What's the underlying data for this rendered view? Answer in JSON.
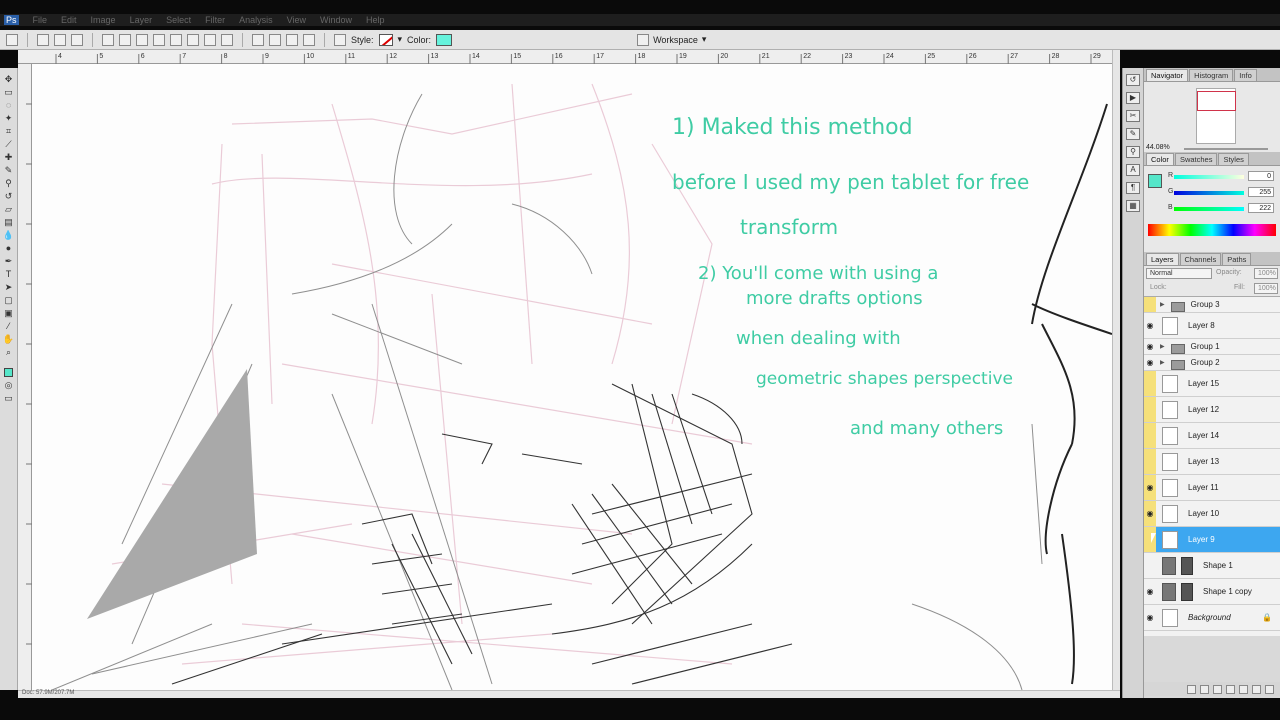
{
  "menubar": {
    "logo": "Ps",
    "items": [
      "File",
      "Edit",
      "Image",
      "Layer",
      "Select",
      "Filter",
      "Analysis",
      "View",
      "Window",
      "Help"
    ]
  },
  "options": {
    "style_label": "Style:",
    "color_label": "Color:",
    "color_value": "#66f2dc",
    "workspace_label": "Workspace"
  },
  "ruler": {
    "ticks": [
      "4",
      "5",
      "6",
      "7",
      "8",
      "9",
      "10",
      "11",
      "12",
      "13",
      "14",
      "15",
      "16",
      "17",
      "18",
      "19",
      "20",
      "21",
      "22",
      "23",
      "24",
      "25",
      "26",
      "27",
      "28",
      "29"
    ]
  },
  "canvas": {
    "note_lines": [
      "1) Maked this method",
      "before I used my pen tablet for free",
      "transform",
      "2) You'll come with using a",
      "more drafts options",
      "when dealing with",
      "geometric shapes perspective",
      "and many others"
    ]
  },
  "status": {
    "text": "Doc: 57.9M/207.7M"
  },
  "navigator": {
    "tabs": [
      "Navigator",
      "Histogram",
      "Info"
    ],
    "zoom": "44.08%"
  },
  "color_panel": {
    "tabs": [
      "Color",
      "Swatches",
      "Styles"
    ],
    "fg_color": "#55e6c9",
    "channels": [
      {
        "label": "R",
        "value": "0"
      },
      {
        "label": "G",
        "value": "255"
      },
      {
        "label": "B",
        "value": "222"
      }
    ]
  },
  "layers_panel": {
    "tabs": [
      "Layers",
      "Channels",
      "Paths"
    ],
    "blend_mode": "Normal",
    "opacity_label": "Opacity:",
    "opacity_value": "100%",
    "lock_label": "Lock:",
    "fill_label": "Fill:",
    "fill_value": "100%",
    "layers": [
      {
        "name": "Group 3",
        "type": "group",
        "eye": false,
        "yellow": true
      },
      {
        "name": "Layer 8",
        "type": "layer",
        "eye": true,
        "yellow": false
      },
      {
        "name": "Group 1",
        "type": "group",
        "eye": true,
        "yellow": false
      },
      {
        "name": "Group 2",
        "type": "group",
        "eye": true,
        "yellow": false
      },
      {
        "name": "Layer 15",
        "type": "layer",
        "eye": false,
        "yellow": true
      },
      {
        "name": "Layer 12",
        "type": "layer",
        "eye": false,
        "yellow": true
      },
      {
        "name": "Layer 14",
        "type": "layer",
        "eye": false,
        "yellow": true
      },
      {
        "name": "Layer 13",
        "type": "layer",
        "eye": false,
        "yellow": true
      },
      {
        "name": "Layer 11",
        "type": "layer",
        "eye": true,
        "yellow": true
      },
      {
        "name": "Layer 10",
        "type": "layer",
        "eye": true,
        "yellow": true
      },
      {
        "name": "Layer 9",
        "type": "layer",
        "eye": false,
        "yellow": true,
        "active": true
      },
      {
        "name": "Shape 1",
        "type": "shape",
        "eye": false,
        "yellow": false
      },
      {
        "name": "Shape 1 copy",
        "type": "shape",
        "eye": true,
        "yellow": false
      },
      {
        "name": "Background",
        "type": "background",
        "eye": true,
        "yellow": false
      }
    ]
  }
}
